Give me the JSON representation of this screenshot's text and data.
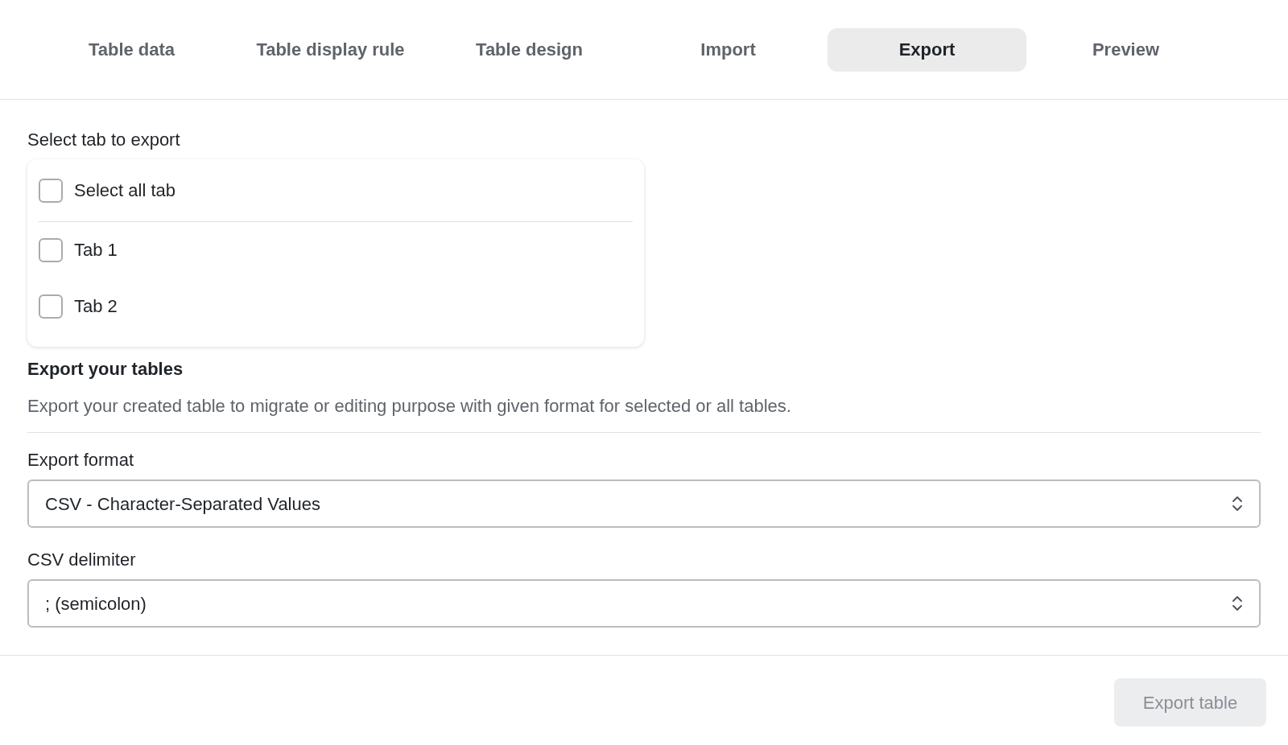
{
  "tabs": [
    {
      "label": "Table data",
      "selected": false
    },
    {
      "label": "Table display rule",
      "selected": false
    },
    {
      "label": "Table design",
      "selected": false
    },
    {
      "label": "Import",
      "selected": false
    },
    {
      "label": "Export",
      "selected": true
    },
    {
      "label": "Preview",
      "selected": false
    }
  ],
  "tab_selection": {
    "label": "Select tab to export",
    "select_all": {
      "label": "Select all tab",
      "checked": false
    },
    "items": [
      {
        "label": "Tab 1",
        "checked": false
      },
      {
        "label": "Tab 2",
        "checked": false
      }
    ]
  },
  "export_section": {
    "heading": "Export your tables",
    "description": "Export your created table to migrate or editing purpose with given format for selected or all tables."
  },
  "fields": [
    {
      "label": "Export format",
      "value": "CSV - Character-Separated Values"
    },
    {
      "label": "CSV delimiter",
      "value": "; (semicolon)"
    }
  ],
  "export_button": {
    "label": "Export table",
    "disabled": true
  }
}
